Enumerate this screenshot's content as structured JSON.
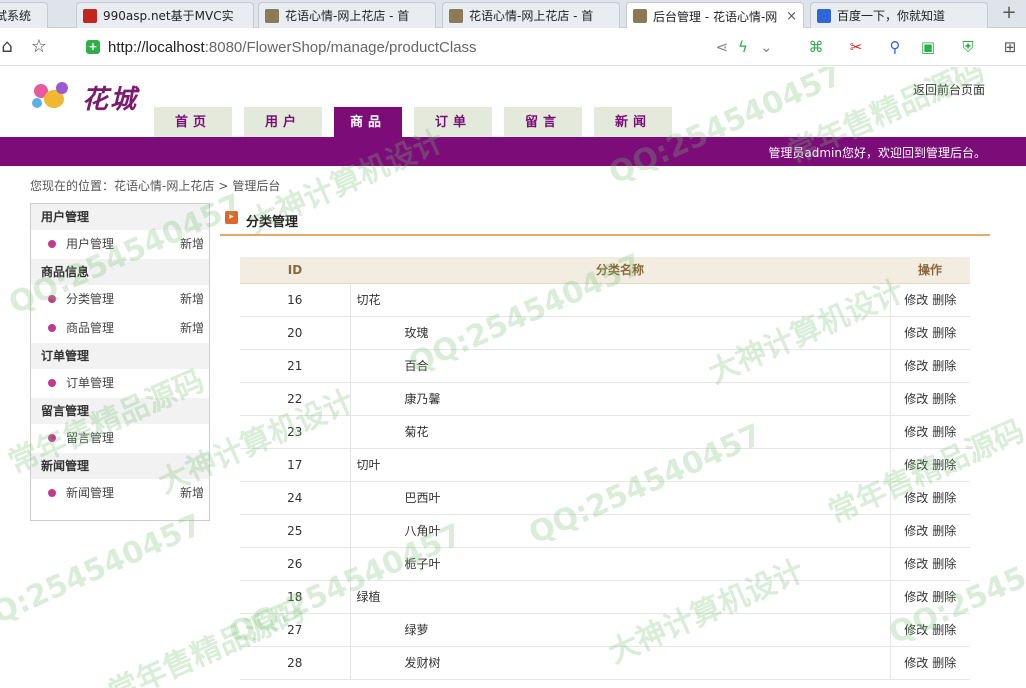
{
  "browser": {
    "tabs": [
      {
        "title": "试系统",
        "favicon_color": "#ffffff"
      },
      {
        "title": "990asp.net基于MVC实",
        "favicon_color": "#c0261e"
      },
      {
        "title": "花语心情-网上花店 - 首",
        "favicon_color": "#8a7a55"
      },
      {
        "title": "花语心情-网上花店 - 首",
        "favicon_color": "#8a7a55"
      },
      {
        "title": "后台管理 - 花语心情-网",
        "favicon_color": "#8a7a55",
        "active": true
      },
      {
        "title": "百度一下，你就知道",
        "favicon_color": "#2f66d8"
      }
    ],
    "close_glyph": "×",
    "new_tab_glyph": "+",
    "url_host": "http://localhost",
    "url_path": ":8080/FlowerShop/manage/productClass",
    "icons": [
      "home-icon",
      "star-icon",
      "share-icon",
      "lightning-icon",
      "translate-icon",
      "scissors-icon",
      "search-icon",
      "gamepad-icon",
      "shield-icon",
      "grid-icon"
    ]
  },
  "site": {
    "brand": "花城",
    "back_link": "返回前台页面",
    "nav": [
      "首页",
      "用户",
      "商品",
      "订单",
      "留言",
      "新闻"
    ],
    "active_nav": 2,
    "welcome": "管理员admin您好，欢迎回到管理后台。",
    "crumb_prefix": "您现在的位置：",
    "crumb_site": "花语心情-网上花店",
    "crumb_sep": ">",
    "crumb_page": "管理后台"
  },
  "sidebar": {
    "groups": [
      {
        "title": "用户管理",
        "items": [
          {
            "label": "用户管理",
            "add": "新增"
          }
        ]
      },
      {
        "title": "商品信息",
        "items": [
          {
            "label": "分类管理",
            "add": "新增"
          },
          {
            "label": "商品管理",
            "add": "新增"
          }
        ]
      },
      {
        "title": "订单管理",
        "items": [
          {
            "label": "订单管理",
            "add": ""
          }
        ]
      },
      {
        "title": "留言管理",
        "items": [
          {
            "label": "留言管理",
            "add": ""
          }
        ]
      },
      {
        "title": "新闻管理",
        "items": [
          {
            "label": "新闻管理",
            "add": "新增"
          }
        ]
      }
    ]
  },
  "content": {
    "title": "分类管理",
    "columns": [
      "ID",
      "分类名称",
      "操作"
    ],
    "edit_label": "修改",
    "delete_label": "删除",
    "rows": [
      {
        "id": "16",
        "name": "切花",
        "child": false
      },
      {
        "id": "20",
        "name": "玫瑰",
        "child": true
      },
      {
        "id": "21",
        "name": "百合",
        "child": true
      },
      {
        "id": "22",
        "name": "康乃馨",
        "child": true
      },
      {
        "id": "23",
        "name": "菊花",
        "child": true
      },
      {
        "id": "17",
        "name": "切叶",
        "child": false
      },
      {
        "id": "24",
        "name": "巴西叶",
        "child": true
      },
      {
        "id": "25",
        "name": "八角叶",
        "child": true
      },
      {
        "id": "26",
        "name": "栀子叶",
        "child": true
      },
      {
        "id": "18",
        "name": "绿植",
        "child": false
      },
      {
        "id": "27",
        "name": "绿萝",
        "child": true
      },
      {
        "id": "28",
        "name": "发财树",
        "child": true
      }
    ]
  },
  "watermarks": [
    "QQ:254540457",
    "大神计算机设计",
    "常年售精品源码"
  ],
  "colors": {
    "purple": "#7b0c78",
    "nav_bg": "#e3eadb",
    "accent_orange": "#e6a96a"
  }
}
